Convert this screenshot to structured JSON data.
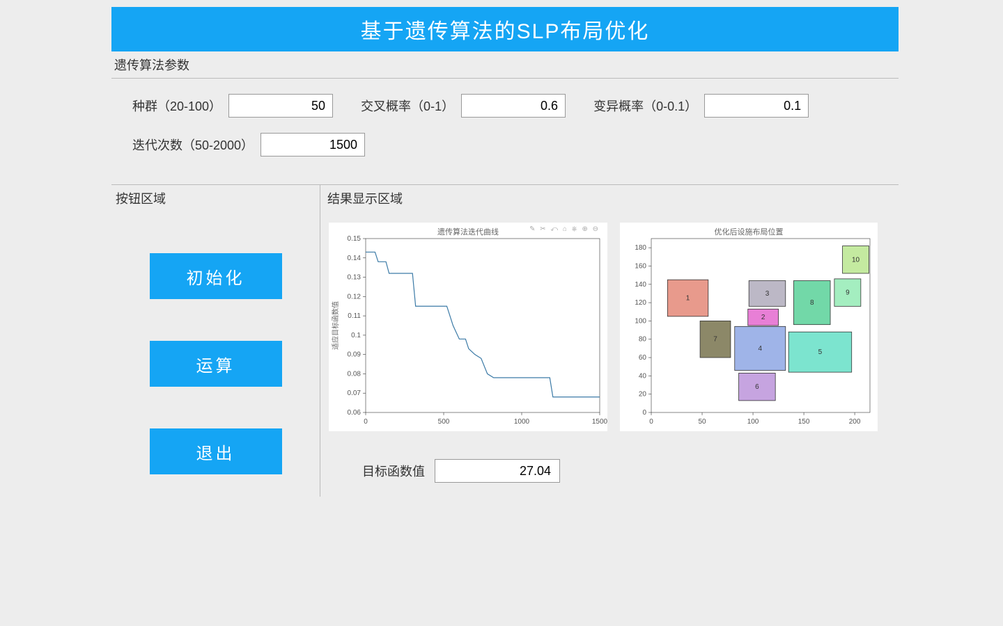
{
  "title": "基于遗传算法的SLP布局优化",
  "panels": {
    "params_label": "遗传算法参数",
    "buttons_label": "按钮区域",
    "results_label": "结果显示区域"
  },
  "params": {
    "population_label": "种群（20-100）",
    "population_value": "50",
    "crossover_label": "交叉概率（0-1）",
    "crossover_value": "0.6",
    "mutation_label": "变异概率（0-0.1）",
    "mutation_value": "0.1",
    "iterations_label": "迭代次数（50-2000）",
    "iterations_value": "1500"
  },
  "buttons": {
    "init": "初始化",
    "run": "运算",
    "exit": "退出"
  },
  "result": {
    "obj_label": "目标函数值",
    "obj_value": "27.04"
  },
  "chart_data": [
    {
      "type": "line",
      "title": "遗传算法迭代曲线",
      "ylabel": "适应目标函数值",
      "xlabel": "",
      "xlim": [
        0,
        1500
      ],
      "ylim": [
        0.06,
        0.15
      ],
      "xticks": [
        0,
        500,
        1000,
        1500
      ],
      "yticks": [
        0.06,
        0.07,
        0.08,
        0.09,
        0.1,
        0.11,
        0.12,
        0.13,
        0.14,
        0.15
      ],
      "series": [
        {
          "name": "best",
          "color": "#3b7aa6",
          "x": [
            0,
            60,
            80,
            130,
            150,
            300,
            320,
            520,
            540,
            560,
            600,
            640,
            660,
            700,
            740,
            780,
            820,
            1180,
            1200,
            1500
          ],
          "y": [
            0.143,
            0.143,
            0.138,
            0.138,
            0.132,
            0.132,
            0.115,
            0.115,
            0.11,
            0.105,
            0.098,
            0.098,
            0.093,
            0.09,
            0.088,
            0.08,
            0.078,
            0.078,
            0.068,
            0.068
          ]
        }
      ],
      "toolbar": "✎ ✂ ⤺ ⌂ ⎈ ⊕ ⊖"
    },
    {
      "type": "layout",
      "title": "优化后设施布局位置",
      "xlim": [
        0,
        215
      ],
      "ylim": [
        0,
        190
      ],
      "xticks": [
        0,
        50,
        100,
        150,
        200
      ],
      "yticks": [
        0,
        20,
        40,
        60,
        80,
        100,
        120,
        140,
        160,
        180
      ],
      "facilities": [
        {
          "id": "1",
          "x": 16,
          "y": 105,
          "w": 40,
          "h": 40,
          "fill": "#e89a8c"
        },
        {
          "id": "7",
          "x": 48,
          "y": 60,
          "w": 30,
          "h": 40,
          "fill": "#8c8868"
        },
        {
          "id": "3",
          "x": 96,
          "y": 116,
          "w": 36,
          "h": 28,
          "fill": "#bcb8c6"
        },
        {
          "id": "2",
          "x": 95,
          "y": 95,
          "w": 30,
          "h": 18,
          "fill": "#e87fd6"
        },
        {
          "id": "4",
          "x": 82,
          "y": 46,
          "w": 50,
          "h": 48,
          "fill": "#9fb4e8"
        },
        {
          "id": "6",
          "x": 86,
          "y": 13,
          "w": 36,
          "h": 30,
          "fill": "#c6a4e0"
        },
        {
          "id": "8",
          "x": 140,
          "y": 96,
          "w": 36,
          "h": 48,
          "fill": "#72d8a8"
        },
        {
          "id": "5",
          "x": 135,
          "y": 44,
          "w": 62,
          "h": 44,
          "fill": "#7ce4cf"
        },
        {
          "id": "9",
          "x": 180,
          "y": 116,
          "w": 26,
          "h": 30,
          "fill": "#a4eec0"
        },
        {
          "id": "10",
          "x": 188,
          "y": 152,
          "w": 26,
          "h": 30,
          "fill": "#c4eaa0"
        }
      ]
    }
  ]
}
